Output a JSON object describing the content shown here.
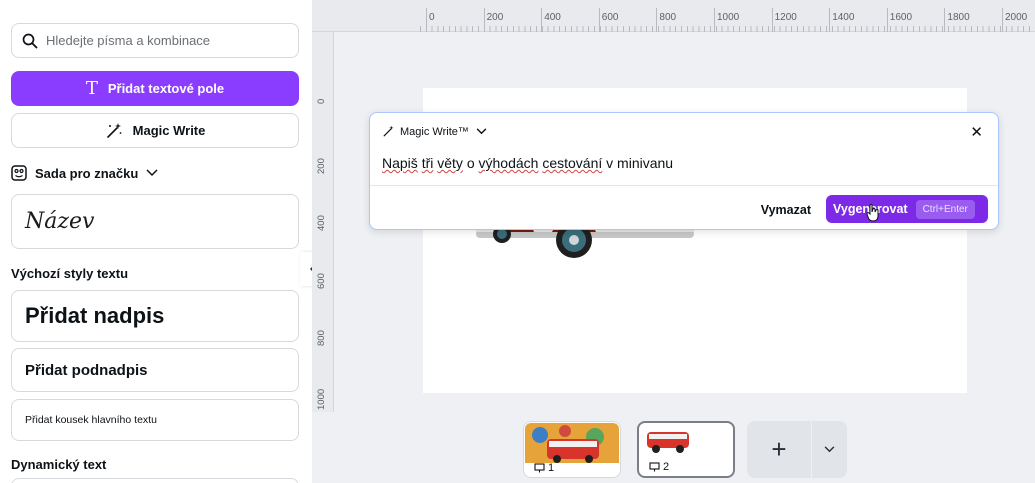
{
  "sidebar": {
    "search_placeholder": "Hledejte písma a kombinace",
    "add_text_label": "Přidat textové pole",
    "magic_write_label": "Magic Write",
    "brand_kit_label": "Sada pro značku",
    "brand_title_sample": "Název",
    "default_styles_label": "Výchozí styly textu",
    "add_heading": "Přidat nadpis",
    "add_subheading": "Přidat podnadpis",
    "add_body": "Přidat kousek hlavního textu",
    "dynamic_text_label": "Dynamický text"
  },
  "ruler": {
    "top_ticks": [
      "0",
      "200",
      "400",
      "600",
      "800",
      "1000",
      "1200",
      "1400",
      "1600",
      "1800",
      "2000"
    ],
    "left_ticks": [
      "0",
      "200",
      "400",
      "600",
      "800",
      "1000"
    ]
  },
  "magic_write": {
    "title": "Magic Write™",
    "prompt_parts": [
      "Napiš",
      " ",
      "tři",
      " ",
      "věty",
      " o ",
      "výhodách",
      " ",
      "cestování",
      " v minivanu"
    ],
    "clear_label": "Vymazat",
    "generate_label": "Vygenerovat",
    "shortcut": "Ctrl+Enter"
  },
  "pages": {
    "thumb1_number": "1",
    "thumb2_number": "2",
    "add_label": "+"
  },
  "colors": {
    "accent": "#8b3dff",
    "generate": "#7d2ae8",
    "van_red": "#d9342b"
  }
}
